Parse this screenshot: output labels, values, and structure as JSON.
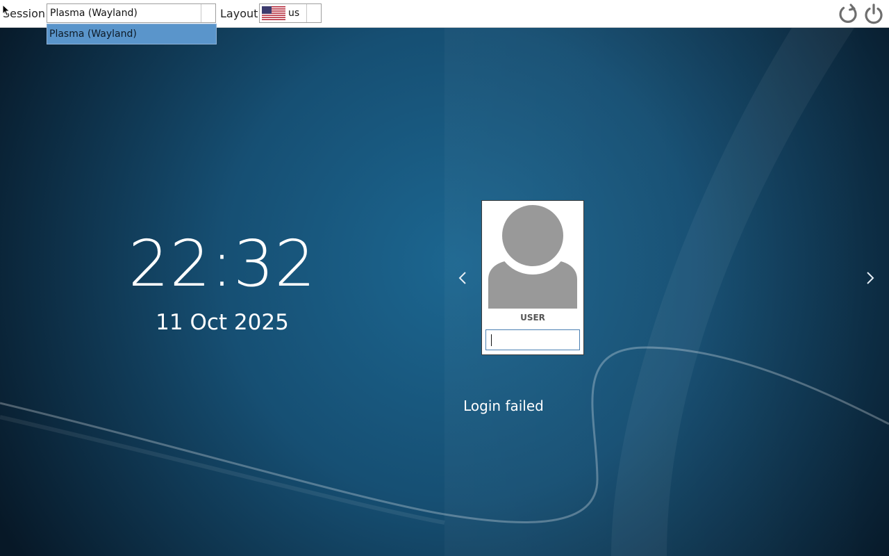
{
  "topbar": {
    "session_label": "Session",
    "session_selected": "Plasma (Wayland)",
    "session_options": [
      "Plasma (Wayland)"
    ],
    "layout_label": "Layout",
    "layout_value": "us",
    "layout_flag_icon": "us-flag-icon",
    "reboot_icon": "reboot-icon",
    "power_icon": "power-icon"
  },
  "clock": {
    "time": "22:32",
    "date": "11 Oct 2025"
  },
  "login": {
    "username": "USER",
    "password_value": "",
    "status": "Login failed"
  },
  "colors": {
    "dropdown_highlight": "#5a95cb",
    "input_border": "#4a7fb2",
    "background_dark": "#0b2a42",
    "avatar_gray": "#999999"
  }
}
